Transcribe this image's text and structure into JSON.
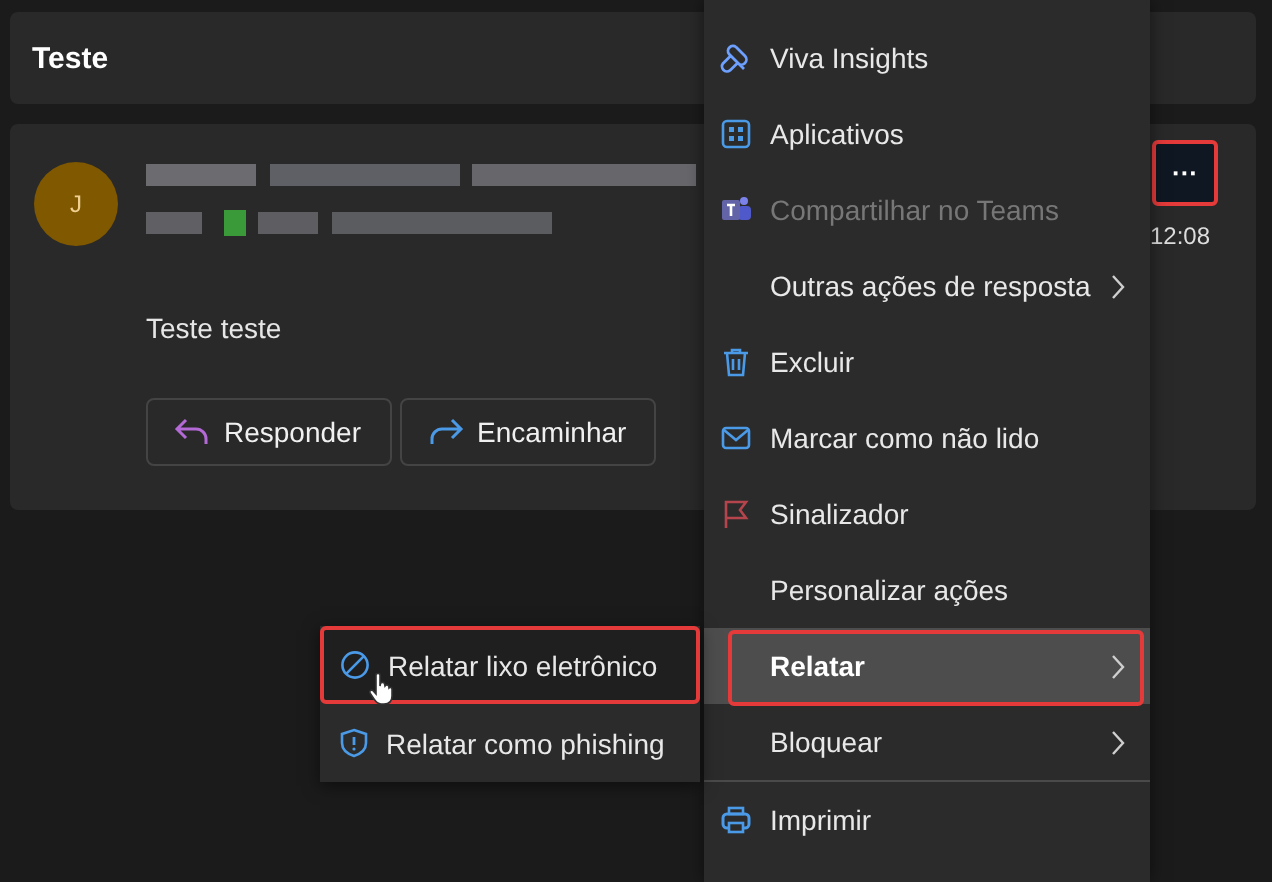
{
  "subject": {
    "title": "Teste"
  },
  "message": {
    "avatar": "J",
    "body": "Teste teste",
    "time": "12:08",
    "more_button": {
      "label": "···",
      "highlighted": true
    },
    "actions": [
      {
        "label": "Responder"
      },
      {
        "label": "Encaminhar"
      }
    ]
  },
  "menu": {
    "items": [
      {
        "label": "Viva Insights",
        "disabled": false,
        "submenu": false,
        "selected": false,
        "highlighted": false
      },
      {
        "label": "Aplicativos",
        "disabled": false,
        "submenu": false,
        "selected": false,
        "highlighted": false
      },
      {
        "label": "Compartilhar no Teams",
        "disabled": true,
        "submenu": false,
        "selected": false,
        "highlighted": false
      },
      {
        "label": "Outras ações de resposta",
        "disabled": false,
        "submenu": true,
        "selected": false,
        "highlighted": false
      },
      {
        "label": "Excluir",
        "disabled": false,
        "submenu": false,
        "selected": false,
        "highlighted": false
      },
      {
        "label": "Marcar como não lido",
        "disabled": false,
        "submenu": false,
        "selected": false,
        "highlighted": false
      },
      {
        "label": "Sinalizador",
        "disabled": false,
        "submenu": false,
        "selected": false,
        "highlighted": false
      },
      {
        "label": "Personalizar ações",
        "disabled": false,
        "submenu": false,
        "selected": false,
        "highlighted": false
      },
      {
        "label": "Relatar",
        "disabled": false,
        "submenu": true,
        "selected": true,
        "highlighted": true
      },
      {
        "label": "Bloquear",
        "disabled": false,
        "submenu": true,
        "selected": false,
        "highlighted": false
      },
      {
        "label": "Imprimir",
        "disabled": false,
        "submenu": false,
        "selected": false,
        "highlighted": false,
        "divider_before": true
      }
    ]
  },
  "submenu": {
    "items": [
      {
        "label": "Relatar lixo eletrônico",
        "selected": true,
        "highlighted": true
      },
      {
        "label": "Relatar como phishing",
        "selected": false,
        "highlighted": false
      }
    ]
  }
}
